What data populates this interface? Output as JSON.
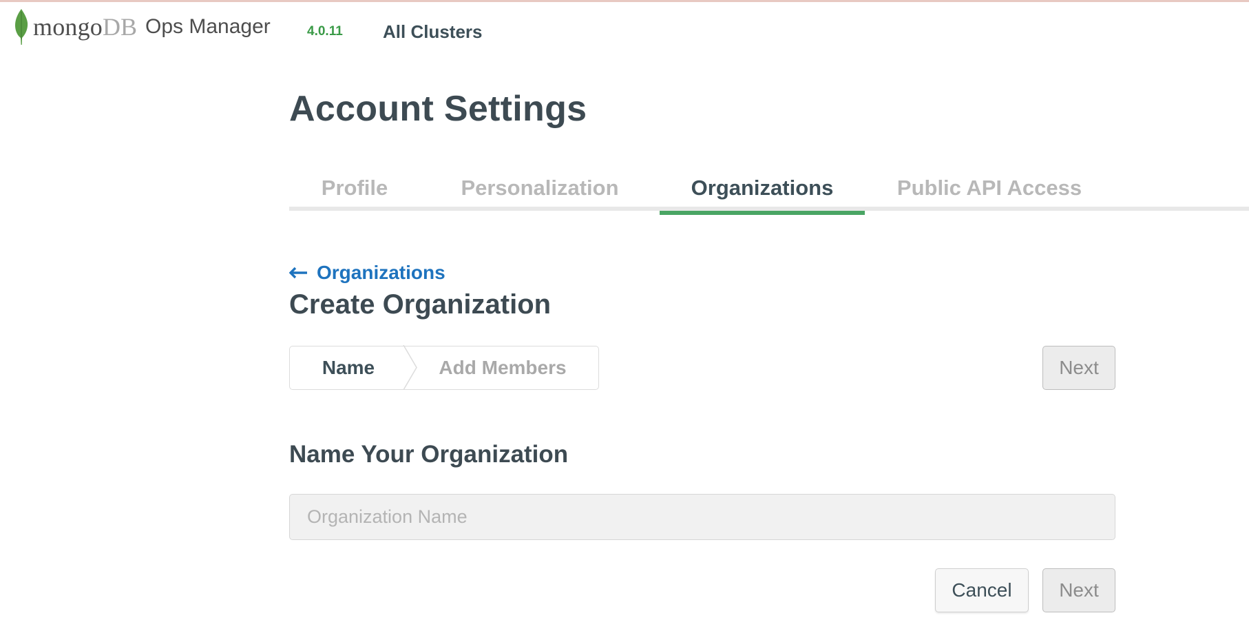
{
  "header": {
    "brand_mongo": "mongo",
    "brand_db": "DB",
    "product": "Ops Manager",
    "version": "4.0.11",
    "nav_all_clusters": "All Clusters"
  },
  "page": {
    "title": "Account Settings"
  },
  "tabs": [
    {
      "label": "Profile",
      "active": false
    },
    {
      "label": "Personalization",
      "active": false
    },
    {
      "label": "Organizations",
      "active": true
    },
    {
      "label": "Public API Access",
      "active": false
    }
  ],
  "back_link": {
    "label": "Organizations",
    "icon": "arrow-left-icon"
  },
  "section": {
    "title": "Create Organization"
  },
  "stepper": {
    "steps": [
      {
        "label": "Name",
        "active": true
      },
      {
        "label": "Add Members",
        "active": false
      }
    ]
  },
  "form": {
    "heading": "Name Your Organization",
    "org_name_value": "",
    "org_name_placeholder": "Organization Name"
  },
  "buttons": {
    "next_top": "Next",
    "cancel": "Cancel",
    "next_bottom": "Next"
  },
  "colors": {
    "accent_green": "#4aa564",
    "link_blue": "#1e73be",
    "version_green": "#3a9a47"
  }
}
